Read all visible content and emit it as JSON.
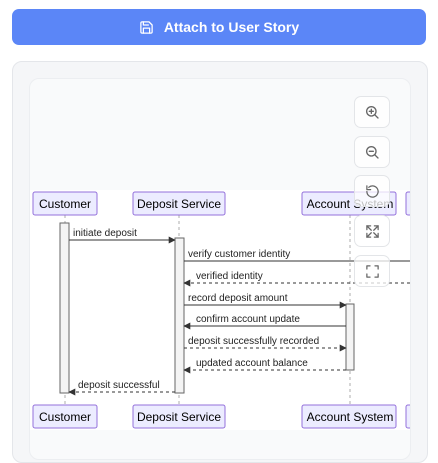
{
  "toolbar": {
    "attach_label": "Attach to User Story"
  },
  "diagram": {
    "participants": [
      {
        "label": "Customer"
      },
      {
        "label": "Deposit Service"
      },
      {
        "label": "Account System"
      }
    ],
    "messages": [
      {
        "text": "initiate deposit"
      },
      {
        "text": "verify customer identity"
      },
      {
        "text": "verified identity"
      },
      {
        "text": "record deposit amount"
      },
      {
        "text": "confirm account update"
      },
      {
        "text": "deposit successfully recorded"
      },
      {
        "text": "updated account balance"
      },
      {
        "text": "deposit successful"
      }
    ]
  },
  "controls": {
    "icons": [
      "zoom-in-icon",
      "zoom-out-icon",
      "reset-icon",
      "fit-icon",
      "fullscreen-icon"
    ]
  },
  "colors": {
    "accent": "#5b86f7",
    "participant_fill": "#ececff",
    "participant_stroke": "#9370db"
  }
}
